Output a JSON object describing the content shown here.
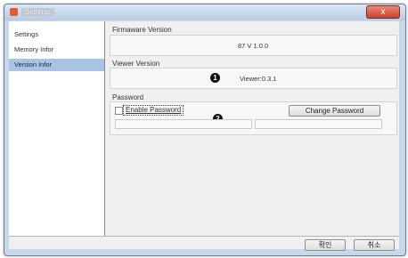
{
  "window": {
    "title": "Settings",
    "close_glyph": "x"
  },
  "sidebar": {
    "items": [
      {
        "label": "Settings"
      },
      {
        "label": "Memory Infor"
      },
      {
        "label": "Version Infor",
        "selected": true
      }
    ]
  },
  "firmware": {
    "label": "Firmaware Version",
    "value": "87 V 1.0.0"
  },
  "viewer": {
    "label": "Viewer Version",
    "value": "Viewer:0.3.1",
    "marker": "1"
  },
  "password": {
    "label": "Password",
    "enable_label": "Enable Password",
    "enable_checked": false,
    "change_button": "Change Password",
    "marker": "2",
    "field1_value": "",
    "field2_value": ""
  },
  "footer": {
    "ok_button": "확인",
    "cancel_button": "취소"
  },
  "colors": {
    "selection": "#a9c4e3",
    "close_button": "#c9412a"
  },
  "icons": {
    "app": "settings-app-icon",
    "close": "close-icon"
  }
}
